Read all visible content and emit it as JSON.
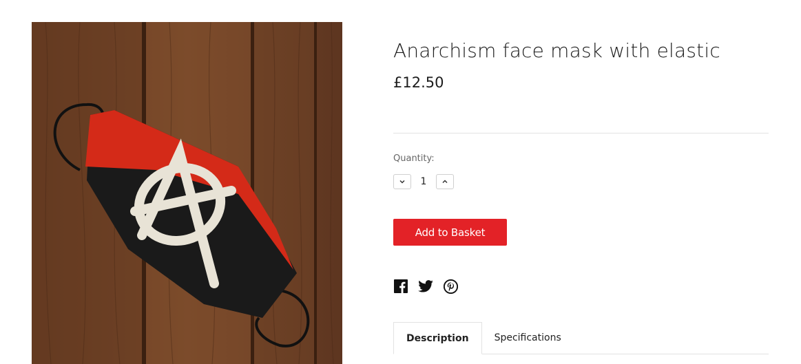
{
  "product": {
    "title": "Anarchism face mask with elastic",
    "price": "£12.50",
    "image_alt": "Red and black anarchism face mask on wooden table",
    "image_icon": "product-photo"
  },
  "quantity": {
    "label": "Quantity:",
    "value": "1",
    "decrement_icon": "chevron-down-icon",
    "increment_icon": "chevron-up-icon"
  },
  "actions": {
    "add_to_basket": "Add to Basket"
  },
  "social": [
    "facebook-icon",
    "twitter-icon",
    "pinterest-icon"
  ],
  "tabs": [
    {
      "label": "Description",
      "active": true
    },
    {
      "label": "Specifications",
      "active": false
    }
  ],
  "colors": {
    "accent": "#e32227",
    "mask_red": "#d42a18",
    "mask_black": "#1a1a1a",
    "wood": "#6a3d22"
  }
}
